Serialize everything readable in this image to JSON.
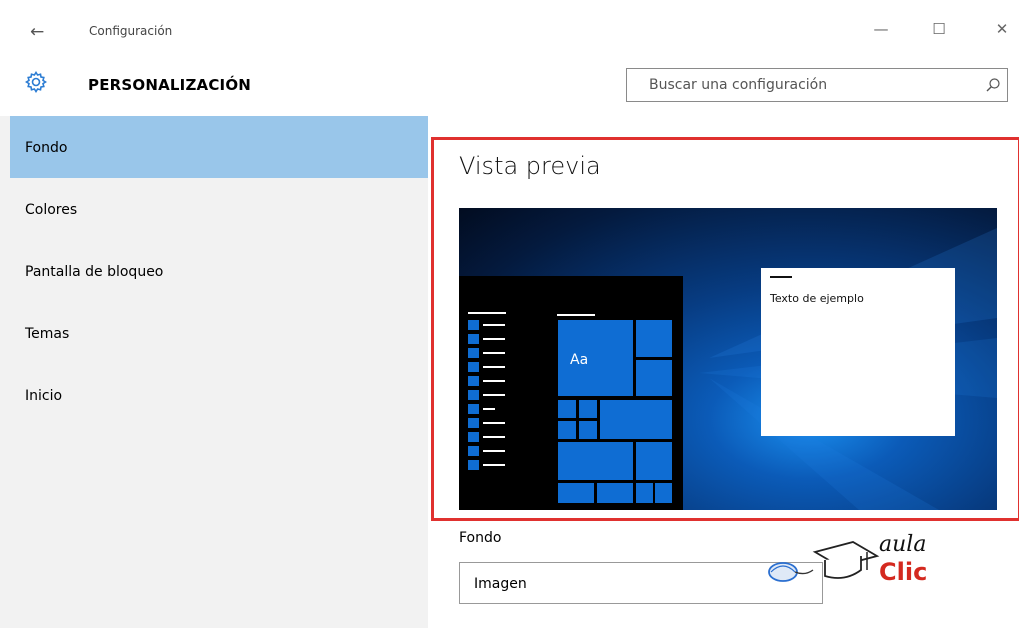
{
  "window": {
    "title": "Configuración",
    "back_glyph": "←",
    "minimize_glyph": "—",
    "maximize_glyph": "☐",
    "close_glyph": "✕"
  },
  "header": {
    "section_title": "PERSONALIZACIÓN",
    "section_icon": "gear-icon",
    "search_placeholder": "Buscar una configuración"
  },
  "sidebar": {
    "items": [
      {
        "label": "Fondo",
        "active": true
      },
      {
        "label": "Colores",
        "active": false
      },
      {
        "label": "Pantalla de bloqueo",
        "active": false
      },
      {
        "label": "Temas",
        "active": false
      },
      {
        "label": "Inicio",
        "active": false
      }
    ]
  },
  "preview": {
    "title": "Vista previa",
    "sample_text": "Texto de ejemplo",
    "tile_label": "Aa"
  },
  "background_setting": {
    "label": "Fondo",
    "value": "Imagen"
  },
  "watermark": {
    "line1": "aula",
    "line2": "Clic"
  },
  "colors": {
    "active_nav": "#99c6ea",
    "highlight_frame": "#e0312f",
    "tile_blue": "#0f6dd3",
    "logo_red": "#d4291f"
  }
}
